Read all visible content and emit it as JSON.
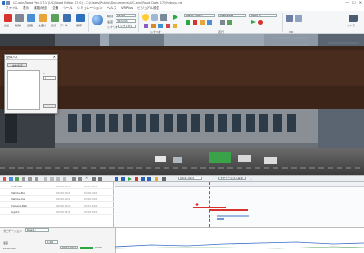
{
  "window": {
    "title": "UC-win/Road Ver.17.0 (UC/Road Editor 17.0) - C:\\Users\\Public\\Documents\\UC-win\\Road Data 17\\Shibuya.rd",
    "minimize": "—",
    "maximize": "☐",
    "close": "✕"
  },
  "menu": [
    "ファイル",
    "表示",
    "道路/地形",
    "交通",
    "ツール",
    "シミュレーション",
    "ヘルプ",
    "VR Plus",
    "ビジュアル設定"
  ],
  "ribbon": {
    "groups": [
      {
        "label": "追加",
        "color": "#d7332c"
      },
      {
        "label": "削除",
        "color": "#7c8792"
      },
      {
        "label": "道路",
        "color": "#4a8fd6"
      },
      {
        "label": "交差点",
        "color": "#e8a53a"
      },
      {
        "label": "表示",
        "color": "#5aa05a"
      },
      {
        "label": "アバター",
        "color": "#3c6fb0"
      },
      {
        "label": "保存",
        "color": "#2f6fc0"
      }
    ],
    "time_label": "時刻",
    "time_value": "12:00",
    "speed_label": "速度",
    "speed_value": "40 km/h",
    "scenario_label": "シナリオ",
    "scenario_value": "シナリオ1",
    "combo1": "Road1 (Main)",
    "combo2": "Walk view",
    "combo3": "Route 1",
    "section_labels": [
      "シナリオ",
      "走行",
      "VR"
    ],
    "right_label": "カメラ"
  },
  "scene": {
    "dialog_title": "全体パス",
    "dialog_button": "全体表示",
    "dialog_item_label": "--",
    "dialog_value": "0"
  },
  "transport": {
    "time_value": "00:01:00.0",
    "mode_value": "ナビゲーション設定",
    "snap_label": "--"
  },
  "timeline": {
    "rows": [
      {
        "name": "Avatar01",
        "start": "00:00:00.0",
        "end": "00:01:00.0"
      },
      {
        "name": "Vehicle-Bus",
        "start": "00:00:10.0",
        "end": "00:00:40.0"
      },
      {
        "name": "Vehicle-Car",
        "start": "00:00:20.0",
        "end": "00:00:50.0"
      },
      {
        "name": "Camera-Path",
        "start": "00:00:00.0",
        "end": "00:01:00.0"
      },
      {
        "name": "Light-1",
        "start": "00:00:05.0",
        "end": "00:00:55.0"
      }
    ]
  },
  "bottom": {
    "label1": "ナビゲーション",
    "combo1": "Road-1",
    "label2": "--",
    "label3": "速度",
    "value_a": "1.00",
    "value_b": "00:01:00.0",
    "row_name": "Landmark",
    "progress_value": "100%"
  }
}
